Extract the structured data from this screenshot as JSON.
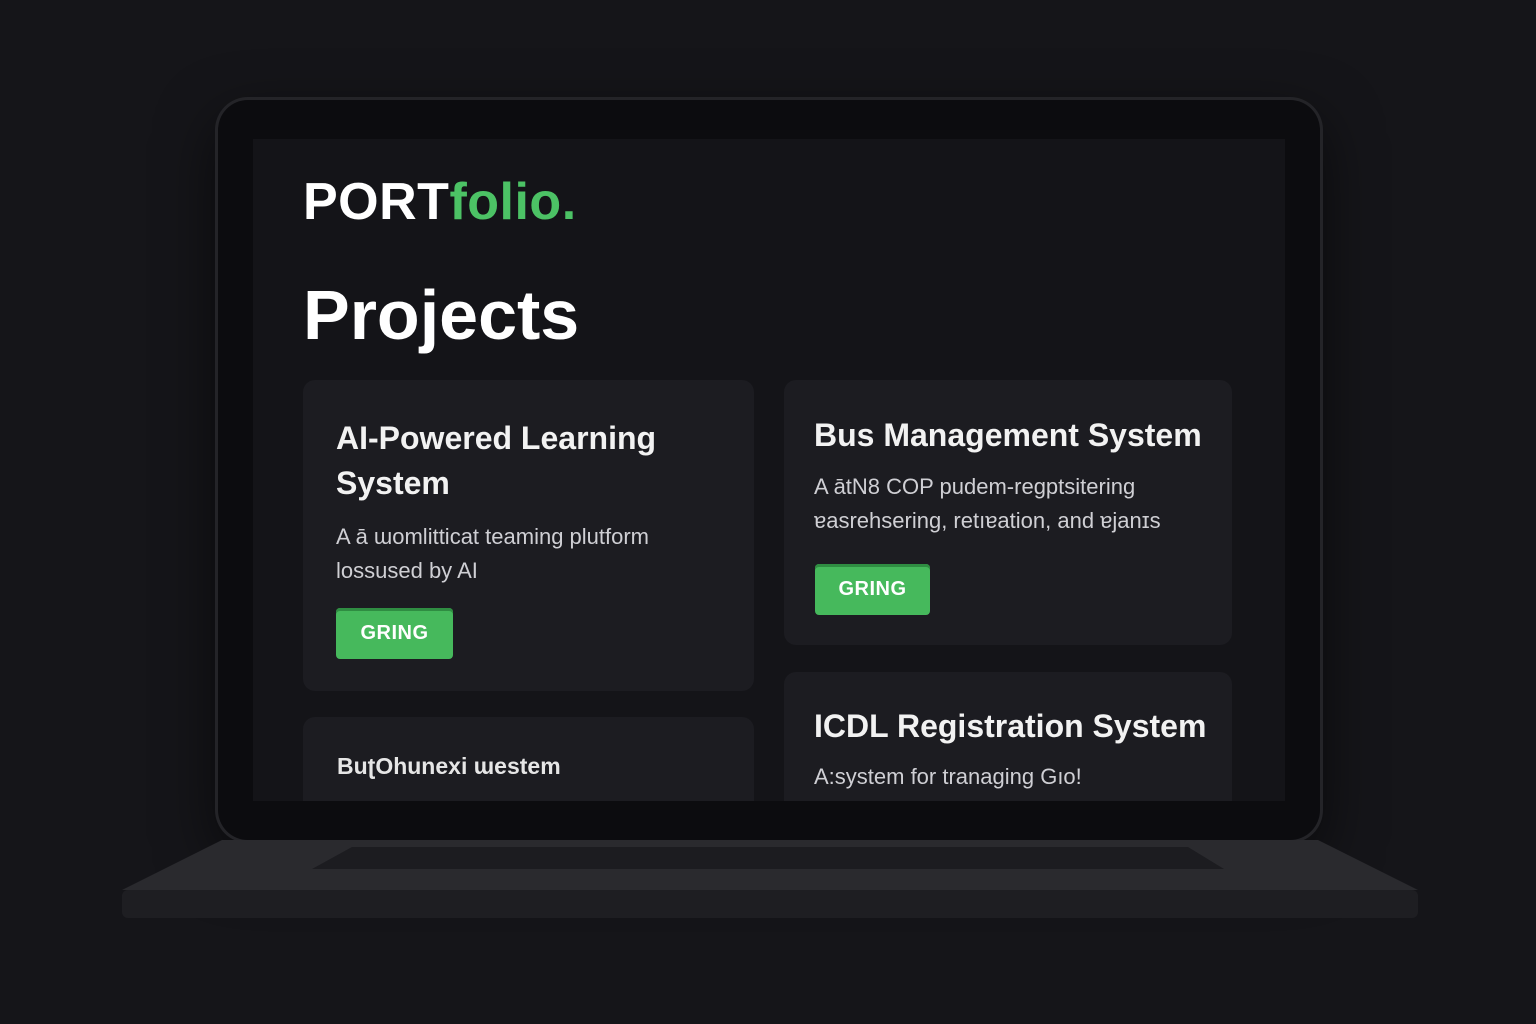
{
  "header": {
    "logo_main": "PORT",
    "logo_accent": "folio."
  },
  "page": {
    "title": "Projects"
  },
  "projects": [
    {
      "title": "AI-Powered Learning System",
      "description": "A ā ɯomlitticat teaming plutform lossused by AI",
      "button_label": "GRING"
    },
    {
      "title": "Bus Management System",
      "description": "A ātN8 COP pudem-regptsitering ɐasrehsering, retıɐation, and ɐjanɪs",
      "button_label": "GRING"
    },
    {
      "title": "BuʈOhunexi ɯestem"
    },
    {
      "title": "ICDL Registration System",
      "description": "A:system for tranaging Gıo!"
    }
  ],
  "colors": {
    "accent": "#4cc265",
    "button": "#46b95c",
    "background": "#151519",
    "card": "#1c1c21"
  }
}
